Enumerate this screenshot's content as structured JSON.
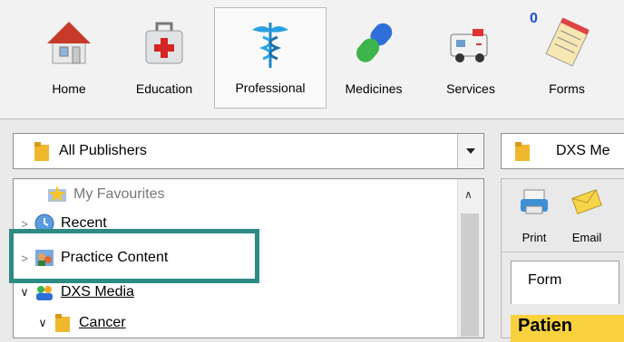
{
  "toolbar": {
    "items": [
      {
        "label": "Home",
        "icon": "house-icon"
      },
      {
        "label": "Education",
        "icon": "first-aid-kit-icon"
      },
      {
        "label": "Professional",
        "icon": "caduceus-icon"
      },
      {
        "label": "Medicines",
        "icon": "capsule-icon"
      },
      {
        "label": "Services",
        "icon": "ambulance-icon"
      },
      {
        "label": "Forms",
        "icon": "forms-notepad-icon",
        "badge": "0"
      }
    ]
  },
  "publisher_select": {
    "value": "All Publishers"
  },
  "tree": {
    "items": [
      {
        "label": "My Favourites",
        "icon": "star-folder-icon"
      },
      {
        "label": "Recent",
        "icon": "clock-icon"
      },
      {
        "label": "Practice Content",
        "icon": "people-icon"
      },
      {
        "label": "DXS Media",
        "icon": "people-icon"
      },
      {
        "label": "Cancer",
        "icon": "folder-icon"
      }
    ]
  },
  "right": {
    "combo_text": "DXS Me",
    "buttons": [
      {
        "label": "Print",
        "icon": "printer-icon"
      },
      {
        "label": "Email",
        "icon": "envelope-icon"
      }
    ],
    "tab_label": "Form",
    "header_text": "Patien"
  },
  "colors": {
    "highlight": "#2d8a84",
    "badge": "#1a4fd6",
    "folder": "#f1b82d"
  }
}
